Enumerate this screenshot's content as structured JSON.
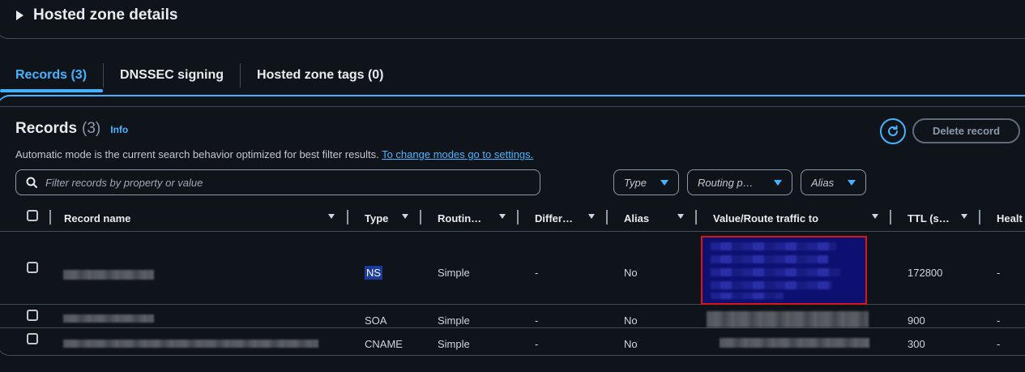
{
  "zone_details": {
    "title": "Hosted zone details"
  },
  "tabs": [
    {
      "label": "Records (3)",
      "active": true
    },
    {
      "label": "DNSSEC signing",
      "active": false
    },
    {
      "label": "Hosted zone tags (0)",
      "active": false
    }
  ],
  "records": {
    "title": "Records",
    "count": "(3)",
    "info": "Info",
    "delete_label": "Delete record",
    "hint_text": "Automatic mode is the current search behavior optimized for best filter results.",
    "hint_link": "To change modes go to settings.",
    "search_placeholder": "Filter records by property or value",
    "filters": {
      "type": "Type",
      "routing": "Routing p…",
      "alias": "Alias"
    }
  },
  "columns": [
    "Record name",
    "Type",
    "Routin…",
    "Differ…",
    "Alias",
    "Value/Route traffic to",
    "TTL (s…",
    "Healt"
  ],
  "rows": [
    {
      "type": "NS",
      "routing": "Simple",
      "differ": "-",
      "alias": "No",
      "ttl": "172800",
      "health": "-"
    },
    {
      "type": "SOA",
      "routing": "Simple",
      "differ": "-",
      "alias": "No",
      "ttl": "900",
      "health": "-"
    },
    {
      "type": "CNAME",
      "routing": "Simple",
      "differ": "-",
      "alias": "No",
      "ttl": "300",
      "health": "-"
    }
  ],
  "colors": {
    "accent": "#42b4ff",
    "highlight_border": "#d91515",
    "border": "#414d5c"
  },
  "icons": {
    "refresh": "refresh-icon",
    "search": "search-icon",
    "caret": "caret-right-icon"
  }
}
